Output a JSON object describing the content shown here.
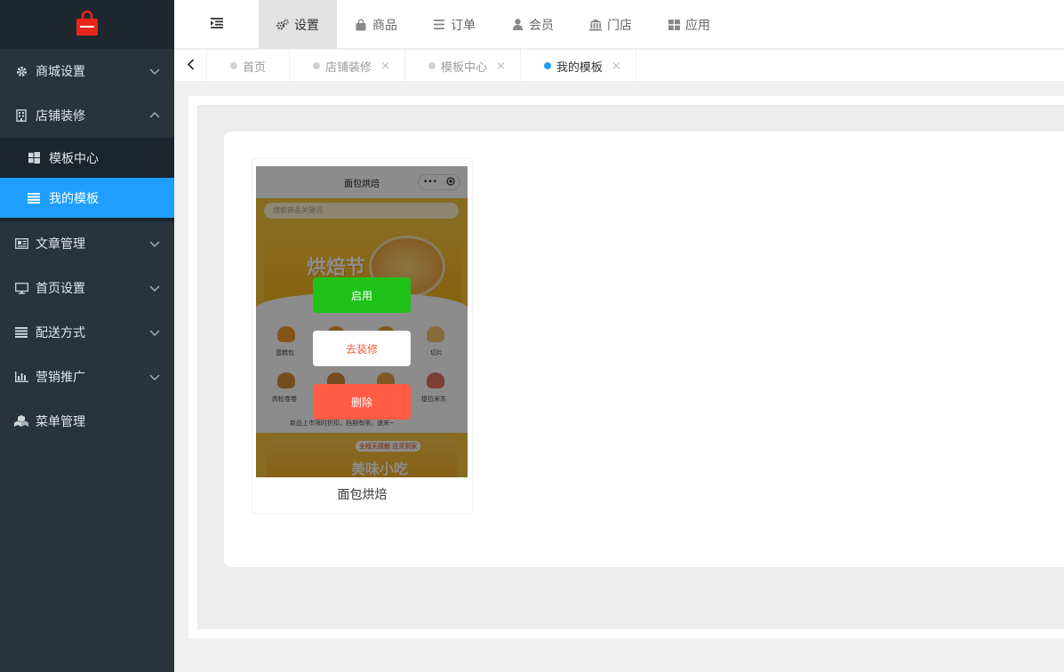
{
  "sidebar": {
    "logo_icon": "shopping-bag-icon",
    "items": [
      {
        "label": "商城设置",
        "icon": "gear-icon"
      },
      {
        "label": "店铺装修",
        "icon": "building-icon"
      },
      {
        "label": "文章管理",
        "icon": "newspaper-icon"
      },
      {
        "label": "首页设置",
        "icon": "monitor-icon"
      },
      {
        "label": "配送方式",
        "icon": "list-icon"
      },
      {
        "label": "营销推广",
        "icon": "bar-chart-icon"
      },
      {
        "label": "菜单管理",
        "icon": "cubes-icon"
      }
    ],
    "submenu": [
      {
        "label": "模板中心",
        "icon": "windows-icon"
      },
      {
        "label": "我的模板",
        "icon": "list-icon"
      }
    ]
  },
  "topnav": {
    "items": [
      {
        "label": "设置",
        "icon": "gears-icon"
      },
      {
        "label": "商品",
        "icon": "shopping-bag-icon"
      },
      {
        "label": "订单",
        "icon": "list-icon"
      },
      {
        "label": "会员",
        "icon": "user-icon"
      },
      {
        "label": "门店",
        "icon": "institution-icon"
      },
      {
        "label": "应用",
        "icon": "grid-icon"
      }
    ]
  },
  "tabs": [
    {
      "label": "首页"
    },
    {
      "label": "店铺装修",
      "close": "×"
    },
    {
      "label": "模板中心",
      "close": "×"
    },
    {
      "label": "我的模板",
      "close": "×"
    }
  ],
  "template": {
    "name": "面包烘焙",
    "preview": {
      "header_title": "面包烘焙",
      "header_dots": "•••",
      "search_placeholder": "搜索商品关键词",
      "banner_title": "烘焙节",
      "categories": [
        "蛋糕包",
        "",
        "",
        "切片",
        "肉松卷卷",
        "",
        "",
        "提拉米苏"
      ],
      "notice": "新品上市限时折扣，档期有限，速来~",
      "promo_tag": "全程无接触 送货到家",
      "promo_title": "美味小吃"
    },
    "actions": {
      "enable": "启用",
      "decorate": "去装修",
      "delete": "删除"
    }
  },
  "colors": {
    "sidebar_bg": "#28333e",
    "accent": "#1e9fff",
    "enable": "#1ec218",
    "delete": "#ff5b45"
  }
}
